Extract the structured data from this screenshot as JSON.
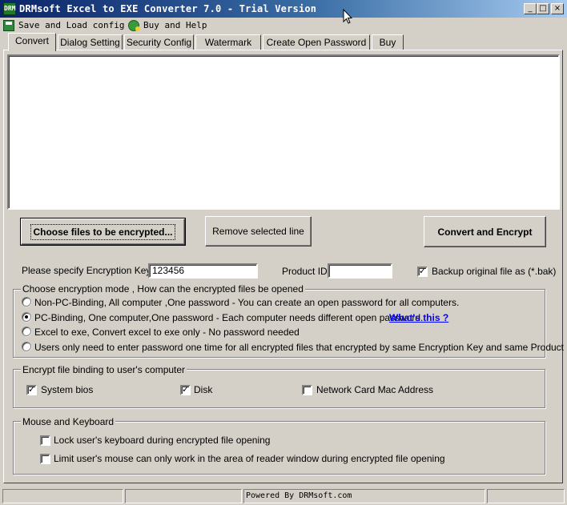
{
  "window": {
    "title": "DRMsoft Excel to EXE Converter 7.0 - Trial Version",
    "icon_text": "DRM",
    "controls": [
      "_",
      "□",
      "×"
    ]
  },
  "menu": {
    "items": [
      {
        "label": "Save and Load config",
        "icon": "save-icon"
      },
      {
        "label": "Buy and Help",
        "icon": "help-icon"
      }
    ]
  },
  "tabs": [
    {
      "label": "Convert",
      "active": true
    },
    {
      "label": "Dialog Setting",
      "active": false
    },
    {
      "label": "Security Config",
      "active": false
    },
    {
      "label": "Watermark",
      "active": false
    },
    {
      "label": "Create Open Password",
      "active": false
    },
    {
      "label": "Buy",
      "active": false
    }
  ],
  "actions": {
    "choose_files": "Choose files to be encrypted...",
    "remove_line": "Remove selected line",
    "convert": "Convert and Encrypt"
  },
  "encryption": {
    "key_label": "Please specify Encryption Key",
    "key_value": "123456",
    "product_id_label": "Product ID",
    "product_id_value": "",
    "backup_label": "Backup original file as (*.bak)",
    "backup_checked": true
  },
  "mode_group": {
    "title": "Choose encryption mode , How can the encrypted files be opened",
    "options": [
      {
        "label": "Non-PC-Binding, All computer ,One password  - You can create an open password for all computers.",
        "selected": false
      },
      {
        "label": "PC-Binding, One computer,One password  - Each computer needs different open password.",
        "selected": true
      },
      {
        "label": "Excel to exe, Convert excel to exe only - No password needed",
        "selected": false
      },
      {
        "label": "Users only need to enter password one time for all encrypted files that encrypted by same Encryption Key and same Product ID.",
        "selected": false
      }
    ],
    "whats_this": "What's this ?"
  },
  "binding_group": {
    "title": "Encrypt file binding to user's computer",
    "items": [
      {
        "label": "System bios",
        "checked": true
      },
      {
        "label": "Disk",
        "checked": true
      },
      {
        "label": "Network Card Mac Address",
        "checked": false
      }
    ]
  },
  "input_group": {
    "title": "Mouse and Keyboard",
    "items": [
      {
        "label": "Lock user's keyboard during encrypted file opening",
        "checked": false
      },
      {
        "label": "Limit user's mouse can only work in the area of reader window during encrypted file opening",
        "checked": false
      }
    ]
  },
  "statusbar": {
    "cells": [
      "",
      "",
      "Powered By DRMsoft.com",
      ""
    ]
  },
  "colors": {
    "titlebar_start": "#0a246a",
    "titlebar_end": "#a6caf0",
    "face": "#d4d0c8",
    "link": "#0000ff"
  }
}
